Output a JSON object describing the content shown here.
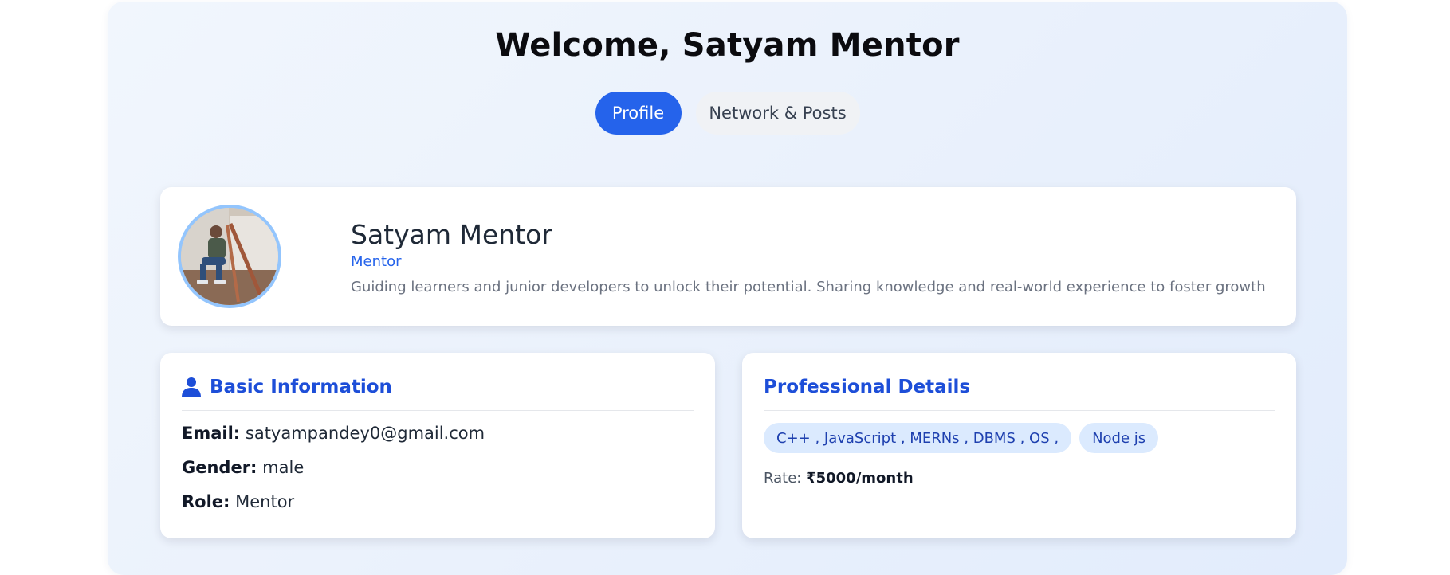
{
  "header": {
    "welcome": "Welcome, Satyam Mentor"
  },
  "tabs": [
    {
      "label": "Profile",
      "active": true
    },
    {
      "label": "Network & Posts",
      "active": false
    }
  ],
  "profile": {
    "name": "Satyam Mentor",
    "role": "Mentor",
    "bio": "Guiding learners and junior developers to unlock their potential. Sharing knowledge and real-world experience to foster growth"
  },
  "basic_info": {
    "title": "Basic Information",
    "icon": "user-icon",
    "email_label": "Email:",
    "email": "satyampandey0@gmail.com",
    "gender_label": "Gender:",
    "gender": "male",
    "role_label": "Role:",
    "role": "Mentor"
  },
  "professional": {
    "title": "Professional Details",
    "skills": [
      "C++ , JavaScript , MERNs , DBMS , OS ,",
      "Node js"
    ],
    "rate_label": "Rate:",
    "rate": "₹5000/month"
  },
  "colors": {
    "accent": "#2563eb",
    "heading_blue": "#1d4ed8",
    "tag_bg": "#dbeafe",
    "avatar_ring": "#93c5fd"
  }
}
